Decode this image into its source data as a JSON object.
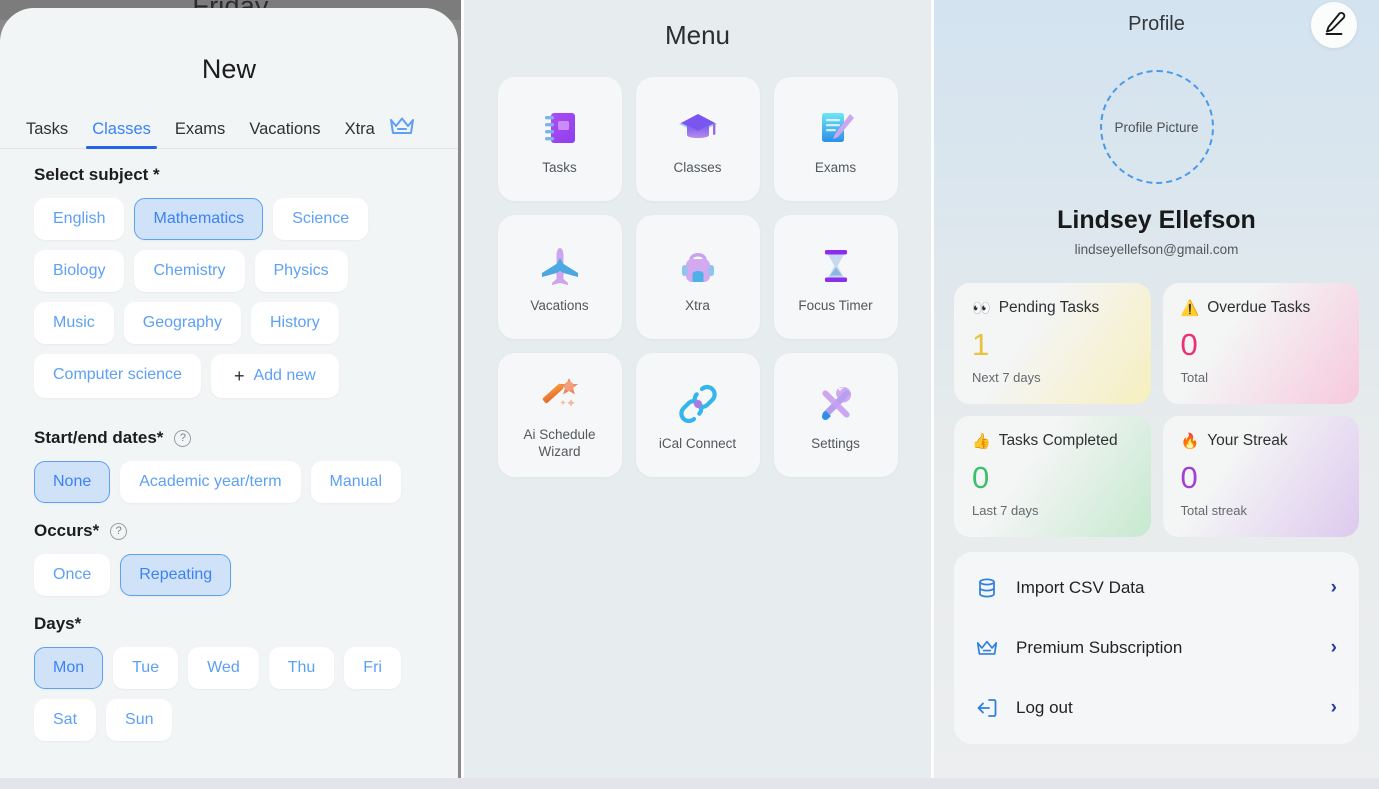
{
  "background": {
    "hidden_title": "Friday"
  },
  "new_sheet": {
    "title": "New",
    "tabs": [
      {
        "label": "Tasks",
        "active": false
      },
      {
        "label": "Classes",
        "active": true
      },
      {
        "label": "Exams",
        "active": false
      },
      {
        "label": "Vacations",
        "active": false
      },
      {
        "label": "Xtra",
        "active": false
      }
    ],
    "premium_icon": "crown-icon",
    "subject": {
      "label": "Select subject *",
      "options": [
        {
          "label": "English",
          "selected": false
        },
        {
          "label": "Mathematics",
          "selected": true
        },
        {
          "label": "Science",
          "selected": false
        },
        {
          "label": "Biology",
          "selected": false
        },
        {
          "label": "Chemistry",
          "selected": false
        },
        {
          "label": "Physics",
          "selected": false
        },
        {
          "label": "Music",
          "selected": false
        },
        {
          "label": "Geography",
          "selected": false
        },
        {
          "label": "History",
          "selected": false
        },
        {
          "label": "Computer science",
          "selected": false
        }
      ],
      "add_new_label": "Add new",
      "add_new_plus": "+"
    },
    "dates": {
      "label": "Start/end dates*",
      "help_icon": "question-mark-icon",
      "options": [
        {
          "label": "None",
          "selected": true
        },
        {
          "label": "Academic year/term",
          "selected": false
        },
        {
          "label": "Manual",
          "selected": false
        }
      ]
    },
    "occurs": {
      "label": "Occurs*",
      "help_icon": "question-mark-icon",
      "options": [
        {
          "label": "Once",
          "selected": false
        },
        {
          "label": "Repeating",
          "selected": true
        }
      ]
    },
    "days": {
      "label": "Days*",
      "options": [
        {
          "label": "Mon",
          "selected": true
        },
        {
          "label": "Tue",
          "selected": false
        },
        {
          "label": "Wed",
          "selected": false
        },
        {
          "label": "Thu",
          "selected": false
        },
        {
          "label": "Fri",
          "selected": false
        },
        {
          "label": "Sat",
          "selected": false
        },
        {
          "label": "Sun",
          "selected": false
        }
      ]
    }
  },
  "menu": {
    "title": "Menu",
    "items": [
      {
        "label": "Tasks",
        "icon": "notebook-icon"
      },
      {
        "label": "Classes",
        "icon": "graduation-cap-icon"
      },
      {
        "label": "Exams",
        "icon": "document-pencil-icon"
      },
      {
        "label": "Vacations",
        "icon": "airplane-icon"
      },
      {
        "label": "Xtra",
        "icon": "backpack-icon"
      },
      {
        "label": "Focus Timer",
        "icon": "hourglass-icon"
      },
      {
        "label": "Ai Schedule Wizard",
        "icon": "magic-wand-icon"
      },
      {
        "label": "iCal Connect",
        "icon": "chain-link-icon"
      },
      {
        "label": "Settings",
        "icon": "tools-icon"
      }
    ]
  },
  "profile": {
    "title": "Profile",
    "edit_icon": "pencil-edit-icon",
    "avatar_placeholder": "Profile Picture",
    "name": "Lindsey Ellefson",
    "email": "lindseyellefson@gmail.com",
    "stats": [
      {
        "emoji": "👀",
        "icon": "eyes-icon",
        "title": "Pending Tasks",
        "value": "1",
        "value_color": "#e8c33f",
        "subtitle": "Next 7 days"
      },
      {
        "emoji": "⚠️",
        "icon": "warning-icon",
        "title": "Overdue Tasks",
        "value": "0",
        "value_color": "#ec2f76",
        "subtitle": "Total"
      },
      {
        "emoji": "👍",
        "icon": "thumbs-up-icon",
        "title": "Tasks Completed",
        "value": "0",
        "value_color": "#3fbf6e",
        "subtitle": "Last 7 days"
      },
      {
        "emoji": "🔥",
        "icon": "fire-icon",
        "title": "Your Streak",
        "value": "0",
        "value_color": "#a33fd4",
        "subtitle": "Total streak"
      }
    ],
    "links": [
      {
        "label": "Import CSV Data",
        "icon": "database-icon",
        "chevron": "›"
      },
      {
        "label": "Premium Subscription",
        "icon": "crown-icon",
        "chevron": "›"
      },
      {
        "label": "Log out",
        "icon": "logout-icon",
        "chevron": "›"
      }
    ]
  }
}
